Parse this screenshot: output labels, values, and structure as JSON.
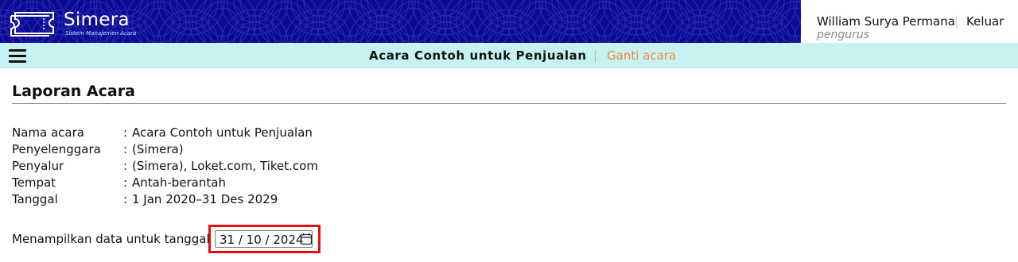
{
  "header": {
    "logo_name": "Simera",
    "logo_tagline": "Sistem Manajemen Acara",
    "user_name": "William Surya Permana",
    "separator": "|",
    "logout_label": "Keluar",
    "user_role": "pengurus",
    "banner_color": "#0b0b96"
  },
  "eventbar": {
    "event_title": "Acara Contoh untuk Penjualan",
    "separator": "|",
    "change_event_label": "Ganti acara",
    "background_color": "#c8f1f1",
    "accent_color": "#f08a3c",
    "menu_icon": "hamburger-menu-icon"
  },
  "main": {
    "page_title": "Laporan Acara",
    "info": [
      {
        "label": "Nama acara",
        "value": "Acara Contoh untuk Penjualan"
      },
      {
        "label": "Penyelenggara",
        "value": "(Simera)"
      },
      {
        "label": "Penyalur",
        "value": "(Simera), Loket.com, Tiket.com"
      },
      {
        "label": "Tempat",
        "value": "Antah-berantah"
      },
      {
        "label": "Tanggal",
        "value": "1 Jan 2020–31 Des 2029"
      }
    ],
    "colon": ":",
    "date_filter_label": "Menampilkan data untuk tanggal:",
    "date_value": "31 / 10 / 2024",
    "date_icon": "calendar-icon",
    "highlight_color": "#e01010"
  }
}
